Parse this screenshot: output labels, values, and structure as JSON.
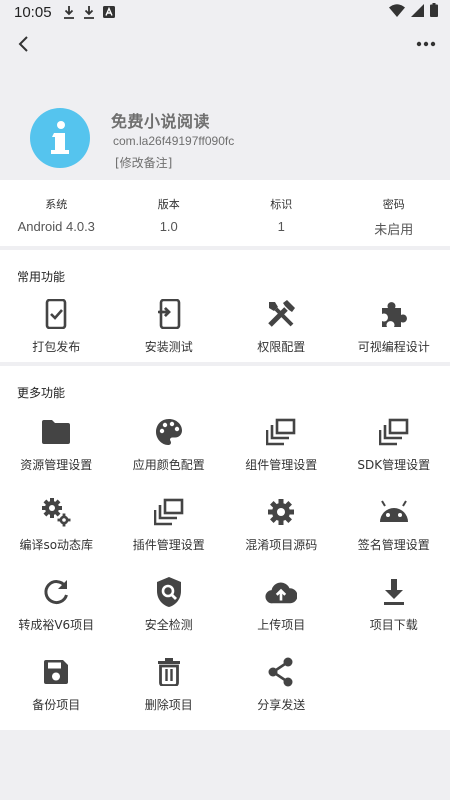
{
  "status_bar": {
    "time": "10:05"
  },
  "app": {
    "name": "免费小说阅读",
    "package": "com.la26f49197ff090fc",
    "note": "[修改备注]"
  },
  "info": [
    {
      "label": "系统",
      "value": "Android 4.0.3"
    },
    {
      "label": "版本",
      "value": "1.0"
    },
    {
      "label": "标识",
      "value": "1"
    },
    {
      "label": "密码",
      "value": "未启用"
    }
  ],
  "common": {
    "title": "常用功能",
    "items": [
      {
        "label": "打包发布",
        "icon": "phone-check-icon"
      },
      {
        "label": "安装测试",
        "icon": "install-phone-icon"
      },
      {
        "label": "权限配置",
        "icon": "tools-icon"
      },
      {
        "label": "可视编程设计",
        "icon": "puzzle-icon"
      }
    ]
  },
  "more": {
    "title": "更多功能",
    "items": [
      {
        "label": "资源管理设置",
        "icon": "folder-icon"
      },
      {
        "label": "应用颜色配置",
        "icon": "palette-icon"
      },
      {
        "label": "组件管理设置",
        "icon": "layers-icon"
      },
      {
        "label": "SDK管理设置",
        "icon": "layers-icon"
      },
      {
        "label": "编译so动态库",
        "icon": "gears-icon"
      },
      {
        "label": "插件管理设置",
        "icon": "layers-icon"
      },
      {
        "label": "混淆项目源码",
        "icon": "gear-icon"
      },
      {
        "label": "签名管理设置",
        "icon": "android-icon"
      },
      {
        "label": "转成裕V6项目",
        "icon": "refresh-icon"
      },
      {
        "label": "安全检测",
        "icon": "shield-search-icon"
      },
      {
        "label": "上传项目",
        "icon": "cloud-upload-icon"
      },
      {
        "label": "项目下载",
        "icon": "download-icon"
      },
      {
        "label": "备份项目",
        "icon": "save-icon"
      },
      {
        "label": "删除项目",
        "icon": "trash-icon"
      },
      {
        "label": "分享发送",
        "icon": "share-icon"
      }
    ]
  },
  "colors": {
    "accent": "#55c4ee",
    "icon": "#444444",
    "background": "#efeff2"
  }
}
